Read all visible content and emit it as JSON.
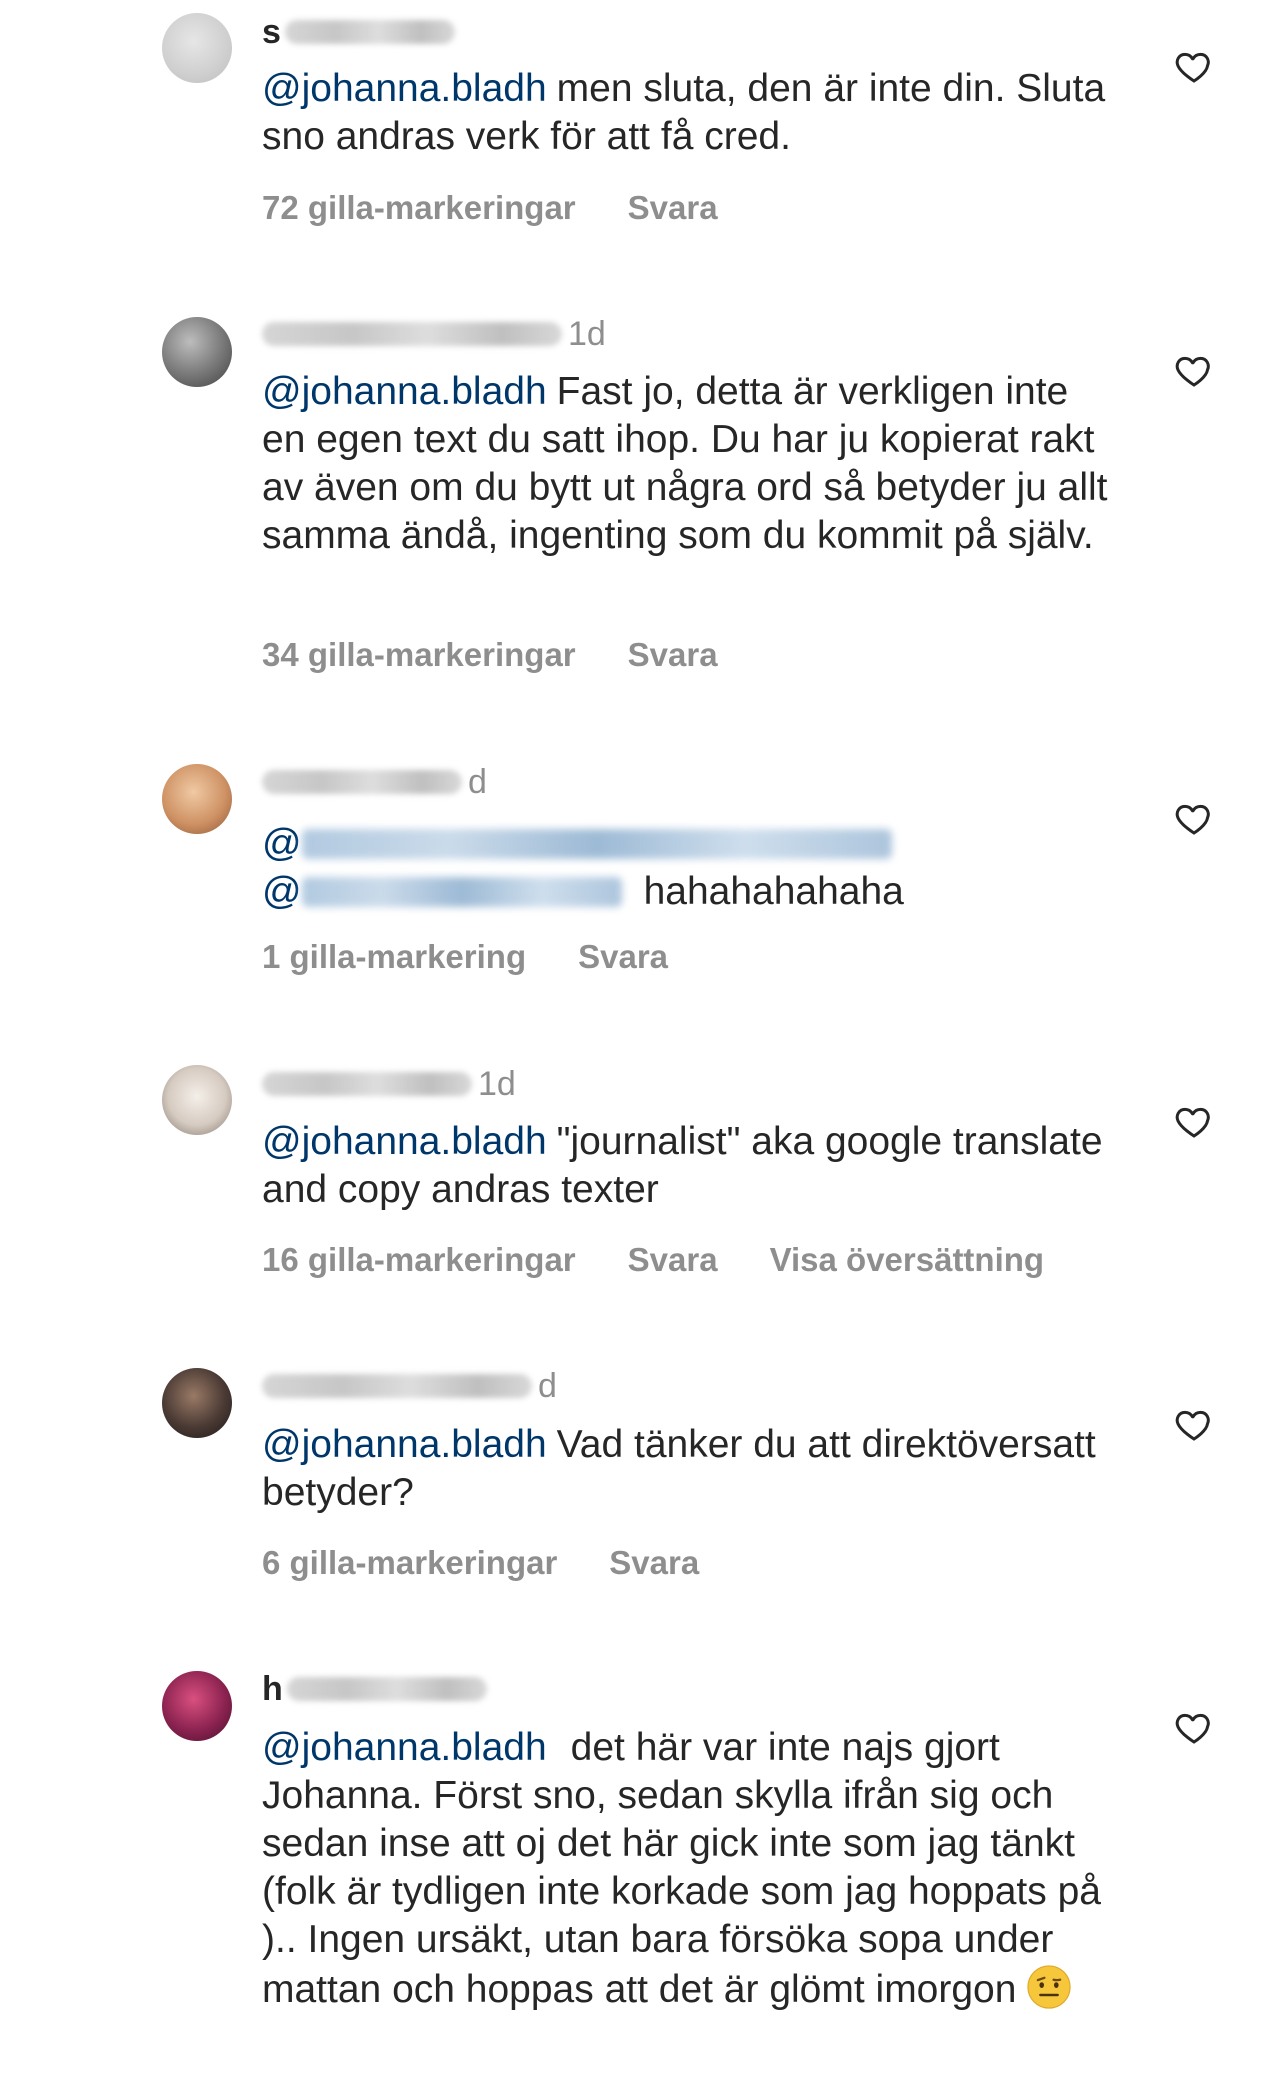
{
  "comments": [
    {
      "name_prefix": "s",
      "time": "",
      "mention": "@johanna.bladh",
      "text": "men sluta, den är inte din. Sluta sno andras verk för att få cred.",
      "likes": "72 gilla-markeringar",
      "reply": "Svara",
      "avatar_colors": [
        "#d9d9d9",
        "#c4c4c4"
      ]
    },
    {
      "name_prefix": "",
      "time": "1d",
      "mention": "@johanna.bladh",
      "text": "Fast jo, detta är verkligen inte en egen text du satt ihop. Du har ju kopierat rakt av även om du bytt ut några ord så betyder ju allt samma ändå, ingenting som du kommit på själv.",
      "likes": "34 gilla-markeringar",
      "reply": "Svara",
      "avatar_colors": [
        "#8a8a8a",
        "#5e5e5e"
      ]
    },
    {
      "name_prefix": "",
      "time": "d",
      "mention_prefix_1": "@",
      "mention_prefix_2": "@",
      "text": "hahahahahaha",
      "likes": "1 gilla-markering",
      "reply": "Svara",
      "avatar_colors": [
        "#d9a074",
        "#b06e45"
      ]
    },
    {
      "name_prefix": "",
      "time": "1d",
      "mention": "@johanna.bladh",
      "text": "\"journalist\" aka google translate and copy andras texter",
      "likes": "16 gilla-markeringar",
      "reply": "Svara",
      "translate": "Visa översättning",
      "avatar_colors": [
        "#e2dcd6",
        "#9b8f86"
      ]
    },
    {
      "name_prefix": "",
      "time": "d",
      "mention": "@johanna.bladh",
      "text": "Vad tänker du att direktöversatt betyder?",
      "likes": "6 gilla-markeringar",
      "reply": "Svara",
      "avatar_colors": [
        "#3d3230",
        "#8a6b5b"
      ]
    },
    {
      "name_prefix": "h",
      "time": "",
      "mention": "@johanna.bladh",
      "text": "det här var inte najs gjort Johanna. Först sno, sedan skylla ifrån sig och sedan inse att oj det här gick inte som jag tänkt (folk är tydligen inte korkade som jag hoppats på ).. Ingen ursäkt, utan bara försöka sopa under mattan och hoppas att det är glömt imorgon",
      "emoji": "raised-eyebrow-emoji",
      "avatar_colors": [
        "#7a1f4a",
        "#b8356b"
      ]
    }
  ],
  "icons": {
    "like": "heart-outline-icon"
  },
  "colors": {
    "mention": "#00376b",
    "text": "#262626",
    "meta": "#8e8e8e"
  }
}
